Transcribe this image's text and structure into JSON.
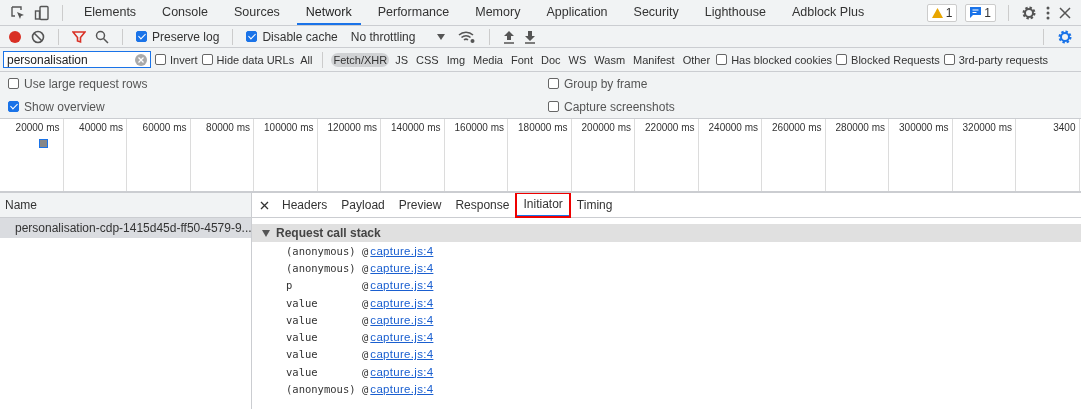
{
  "main_tabs": [
    {
      "label": "Elements",
      "selected": false
    },
    {
      "label": "Console",
      "selected": false
    },
    {
      "label": "Sources",
      "selected": false
    },
    {
      "label": "Network",
      "selected": true
    },
    {
      "label": "Performance",
      "selected": false
    },
    {
      "label": "Memory",
      "selected": false
    },
    {
      "label": "Application",
      "selected": false
    },
    {
      "label": "Security",
      "selected": false
    },
    {
      "label": "Lighthouse",
      "selected": false
    },
    {
      "label": "Adblock Plus",
      "selected": false
    }
  ],
  "badges": {
    "warnings": "1",
    "messages": "1"
  },
  "toolbar": {
    "recording": true,
    "preserve_log": {
      "label": "Preserve log",
      "checked": true
    },
    "disable_cache": {
      "label": "Disable cache",
      "checked": true
    },
    "throttling": "No throttling"
  },
  "filter": {
    "value": "personalisation",
    "checks_before": [
      {
        "label": "Invert",
        "checked": false
      },
      {
        "label": "Hide data URLs",
        "checked": false
      }
    ],
    "types": [
      {
        "label": "All",
        "selected": false
      },
      {
        "label": "Fetch/XHR",
        "selected": true
      },
      {
        "label": "JS",
        "selected": false
      },
      {
        "label": "CSS",
        "selected": false
      },
      {
        "label": "Img",
        "selected": false
      },
      {
        "label": "Media",
        "selected": false
      },
      {
        "label": "Font",
        "selected": false
      },
      {
        "label": "Doc",
        "selected": false
      },
      {
        "label": "WS",
        "selected": false
      },
      {
        "label": "Wasm",
        "selected": false
      },
      {
        "label": "Manifest",
        "selected": false
      },
      {
        "label": "Other",
        "selected": false
      }
    ],
    "checks_after": [
      {
        "label": "Has blocked cookies",
        "checked": false
      },
      {
        "label": "Blocked Requests",
        "checked": false
      },
      {
        "label": "3rd-party requests",
        "checked": false
      }
    ]
  },
  "options": [
    {
      "label": "Use large request rows",
      "checked": false
    },
    {
      "label": "Group by frame",
      "checked": false
    },
    {
      "label": "Show overview",
      "checked": true
    },
    {
      "label": "Capture screenshots",
      "checked": false
    }
  ],
  "overview": {
    "ticks": [
      "20000 ms",
      "40000 ms",
      "60000 ms",
      "80000 ms",
      "100000 ms",
      "120000 ms",
      "140000 ms",
      "160000 ms",
      "180000 ms",
      "200000 ms",
      "220000 ms",
      "240000 ms",
      "260000 ms",
      "280000 ms",
      "300000 ms",
      "320000 ms",
      "3400"
    ]
  },
  "requests": {
    "column": "Name",
    "rows": [
      {
        "name": "personalisation-cdp-1415d45d-ff50-4579-9...",
        "selected": true
      }
    ]
  },
  "detail": {
    "tabs": [
      {
        "label": "Headers",
        "selected": false,
        "highlighted": false
      },
      {
        "label": "Payload",
        "selected": false,
        "highlighted": false
      },
      {
        "label": "Preview",
        "selected": false,
        "highlighted": false
      },
      {
        "label": "Response",
        "selected": false,
        "highlighted": false
      },
      {
        "label": "Initiator",
        "selected": true,
        "highlighted": true
      },
      {
        "label": "Timing",
        "selected": false,
        "highlighted": false
      }
    ],
    "section": {
      "title": "Request call stack",
      "expanded": true
    },
    "stack": [
      {
        "function": "(anonymous)",
        "at": "@",
        "location": "capture.js:4"
      },
      {
        "function": "(anonymous)",
        "at": "@",
        "location": "capture.js:4"
      },
      {
        "function": "p",
        "at": "@",
        "location": "capture.js:4"
      },
      {
        "function": "value",
        "at": "@",
        "location": "capture.js:4"
      },
      {
        "function": "value",
        "at": "@",
        "location": "capture.js:4"
      },
      {
        "function": "value",
        "at": "@",
        "location": "capture.js:4"
      },
      {
        "function": "value",
        "at": "@",
        "location": "capture.js:4"
      },
      {
        "function": "value",
        "at": "@",
        "location": "capture.js:4"
      },
      {
        "function": "(anonymous)",
        "at": "@",
        "location": "capture.js:4"
      }
    ]
  }
}
